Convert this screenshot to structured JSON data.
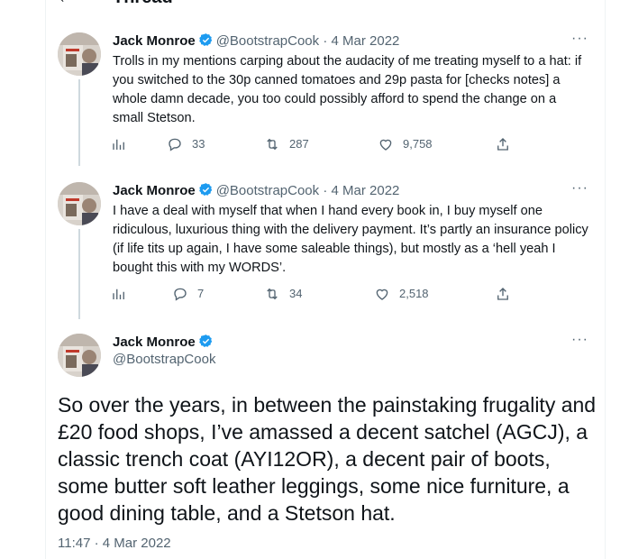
{
  "header": {
    "title": "Thread"
  },
  "tweets": [
    {
      "name": "Jack Monroe",
      "handle": "@BootstrapCook",
      "date": "4 Mar 2022",
      "separator": "·",
      "more": "···",
      "text": "Trolls in my mentions carping about the audacity of me treating myself to a hat: if you switched to the 30p canned tomatoes and 29p pasta for [checks notes] a whole damn decade, you too could possibly afford to spend the change on a small Stetson.",
      "replies": "33",
      "retweets": "287",
      "likes": "9,758"
    },
    {
      "name": "Jack Monroe",
      "handle": "@BootstrapCook",
      "date": "4 Mar 2022",
      "separator": "·",
      "more": "···",
      "text": "I have a deal with myself that when I hand every book in, I buy myself one ridiculous, luxurious thing with the delivery payment. It’s partly an insurance policy (if life tits up again, I have some saleable things), but mostly as a ‘hell yeah I bought this with my WORDS’.",
      "replies": "7",
      "retweets": "34",
      "likes": "2,518"
    }
  ],
  "main_tweet": {
    "name": "Jack Monroe",
    "handle": "@BootstrapCook",
    "more": "···",
    "text": "So over the years, in between the painstaking frugality and £20 food shops, I’ve amassed a decent satchel (AGCJ), a classic trench coat (AYI12OR), a decent pair of boots, some butter soft leather leggings, some nice furniture, a good dining table, and a Stetson hat.",
    "timestamp": "11:47 · 4 Mar 2022"
  },
  "colors": {
    "text": "#0f1419",
    "muted": "#536471",
    "verified": "#1d9bf0",
    "border": "#eff3f4"
  }
}
